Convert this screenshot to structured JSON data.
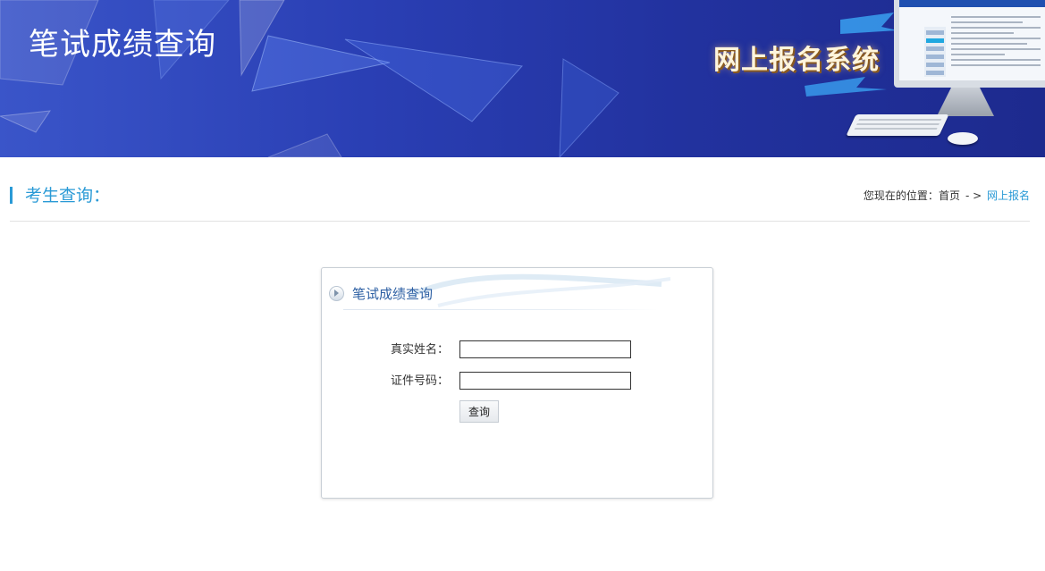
{
  "banner": {
    "title": "笔试成绩查询",
    "system_name": "网上报名系统"
  },
  "section": {
    "title": "考生查询："
  },
  "breadcrumb": {
    "prefix": "您现在的位置：",
    "home": "首页",
    "separator": "- >",
    "current": "网上报名"
  },
  "query_box": {
    "title": "笔试成绩查询",
    "name_label": "真实姓名：",
    "name_value": "",
    "id_label": "证件号码：",
    "id_value": "",
    "submit_label": "查询"
  },
  "colors": {
    "accent": "#2a9ad6",
    "banner_blue": "#22329f",
    "box_title": "#2c5fa3"
  },
  "icons": [
    "circle-arrow-right-icon",
    "computer-monitor-illustration"
  ]
}
